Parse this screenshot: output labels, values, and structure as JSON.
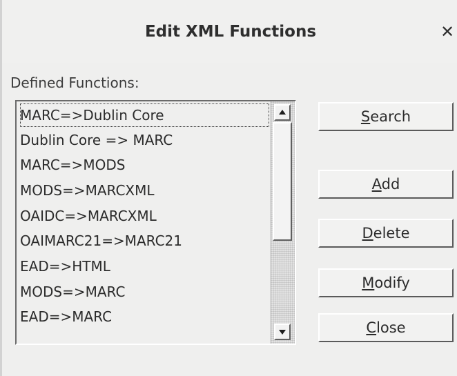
{
  "window": {
    "title": "Edit XML Functions",
    "close_icon": "close-icon"
  },
  "functions": {
    "label": "Defined Functions:",
    "items": [
      "MARC=>Dublin Core",
      "Dublin Core => MARC",
      "MARC=>MODS",
      "MODS=>MARCXML",
      "OAIDC=>MARCXML",
      "OAIMARC21=>MARC21",
      "EAD=>HTML",
      "MODS=>MARC",
      "EAD=>MARC"
    ],
    "focused_index": 0
  },
  "buttons": {
    "search": {
      "mnemonic": "S",
      "rest": "earch"
    },
    "add": {
      "mnemonic": "A",
      "rest": "dd"
    },
    "delete": {
      "mnemonic": "D",
      "rest": "elete"
    },
    "modify": {
      "mnemonic": "M",
      "rest": "odify"
    },
    "close": {
      "mnemonic": "C",
      "rest": "lose"
    }
  },
  "icons": {
    "scroll_up": "arrow-up-icon",
    "scroll_down": "arrow-down-icon"
  }
}
